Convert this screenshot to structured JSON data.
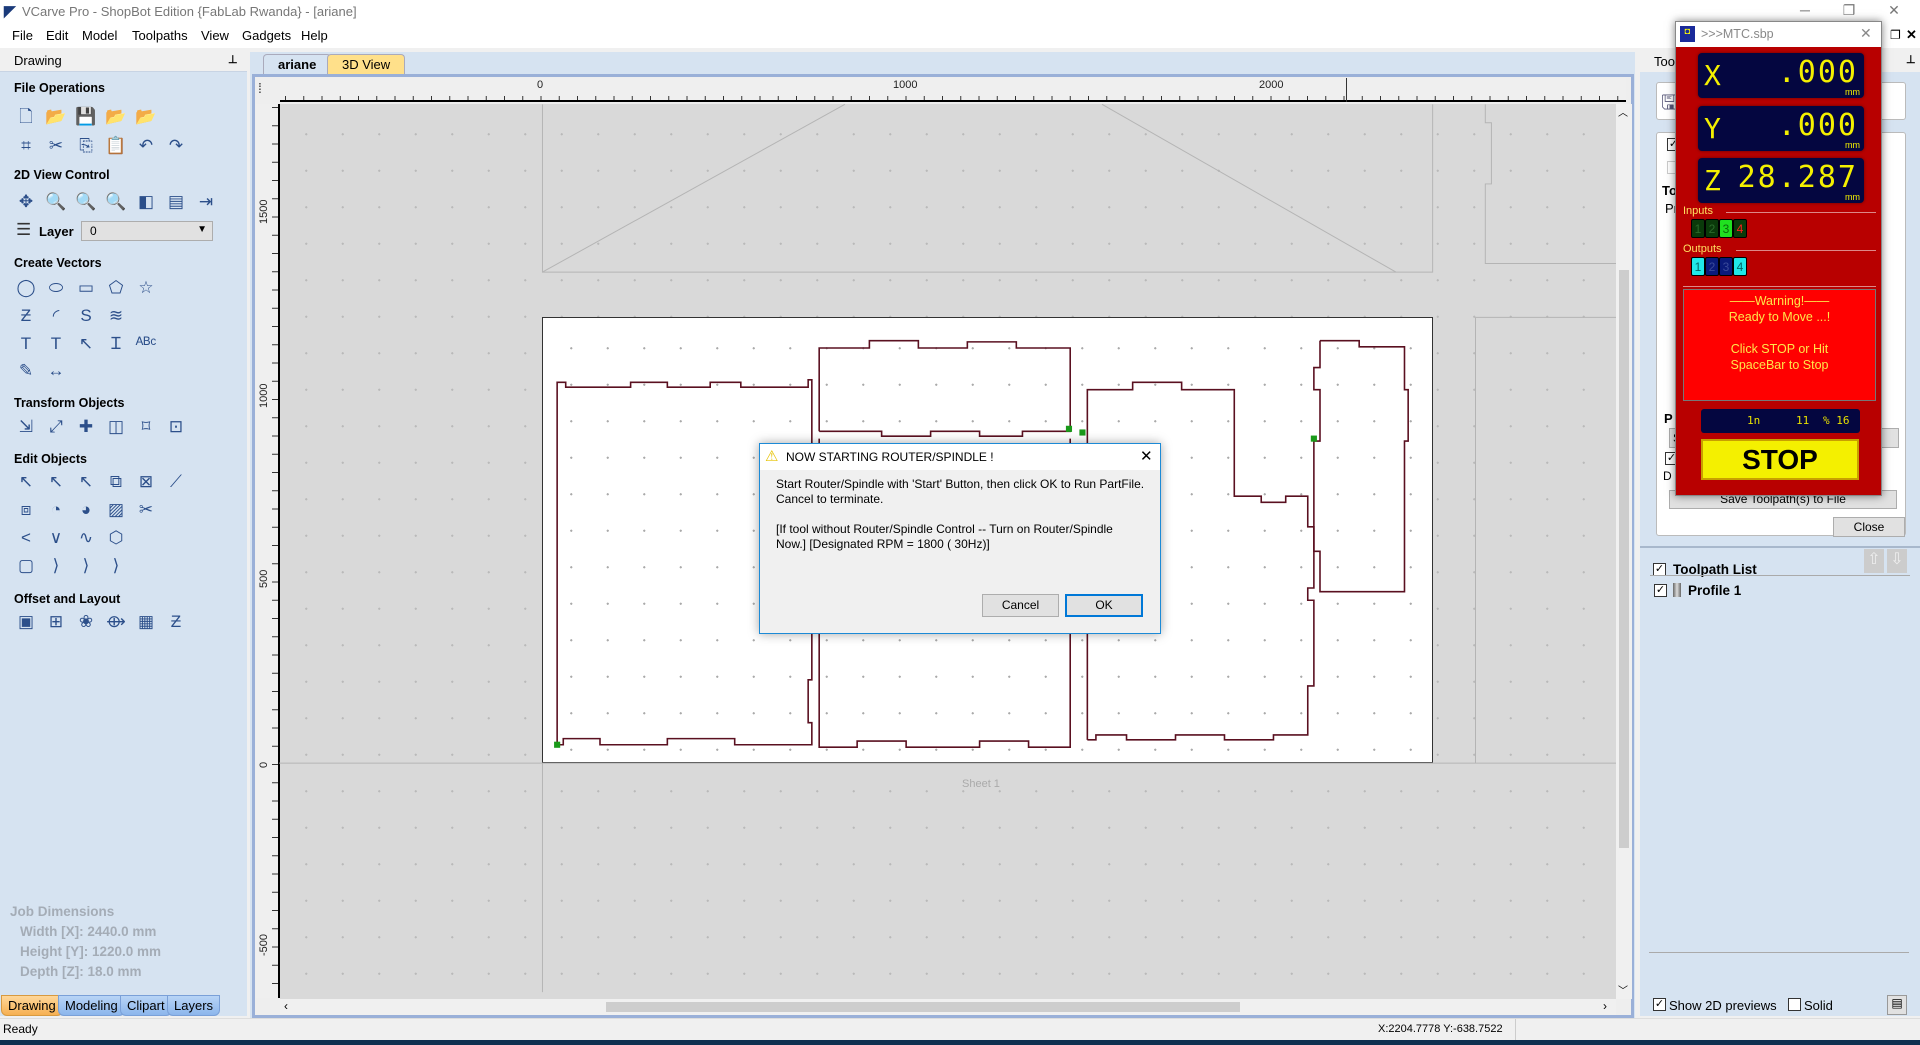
{
  "window": {
    "title": "VCarve Pro - ShopBot Edition {FabLab Rwanda} - [ariane]",
    "minimize": "─",
    "restore": "❐",
    "close": "✕"
  },
  "menu": [
    "File",
    "Edit",
    "Model",
    "Toolpaths",
    "View",
    "Gadgets",
    "Help"
  ],
  "left_panel": {
    "title": "Drawing",
    "sections": {
      "file_operations": "File Operations",
      "view_control": "2D View Control",
      "create_vectors": "Create Vectors",
      "transform": "Transform Objects",
      "edit": "Edit Objects",
      "offset": "Offset and Layout"
    },
    "layer_label": "Layer",
    "layer_value": "0",
    "job_dimensions": {
      "title": "Job Dimensions",
      "width": "Width  [X]: 2440.0 mm",
      "height": "Height [Y]: 1220.0 mm",
      "depth": "Depth  [Z]: 18.0 mm"
    },
    "tabs": [
      "Drawing",
      "Modeling",
      "Clipart",
      "Layers"
    ]
  },
  "icons": {
    "file_operations": [
      [
        "new-file",
        "🗋"
      ],
      [
        "open-folder",
        "📂"
      ],
      [
        "save",
        "💾"
      ],
      [
        "open-recent",
        "📂"
      ],
      [
        "import",
        "📂"
      ],
      [
        "select-all",
        "⌗"
      ],
      [
        "cut",
        "✂"
      ],
      [
        "copy",
        "⎘"
      ],
      [
        "paste",
        "📋"
      ],
      [
        "undo",
        "↶"
      ],
      [
        "redo",
        "↷"
      ]
    ],
    "view_control": [
      [
        "pan",
        "✥"
      ],
      [
        "zoom-box",
        "🔍"
      ],
      [
        "zoom-fit",
        "🔍"
      ],
      [
        "zoom-selection",
        "🔍"
      ],
      [
        "view-left",
        "◧"
      ],
      [
        "view-center",
        "▤"
      ],
      [
        "view-right",
        "⇥"
      ]
    ],
    "create_vectors": [
      [
        "circle",
        "◯"
      ],
      [
        "ellipse",
        "⬭"
      ],
      [
        "rectangle",
        "▭"
      ],
      [
        "polygon",
        "⬠"
      ],
      [
        "star",
        "☆"
      ],
      [
        "polyline",
        "Ƶ"
      ],
      [
        "arc",
        "◜"
      ],
      [
        "curve",
        "S"
      ],
      [
        "fill-pattern",
        "≋"
      ],
      [
        "text",
        "T"
      ],
      [
        "text-box",
        "T"
      ],
      [
        "text-on-curve",
        "↖"
      ],
      [
        "auto-text",
        "Ɪ"
      ],
      [
        "arc-text",
        "ᴬᴮᶜ"
      ],
      [
        "bitmap-trace",
        "✎"
      ],
      [
        "dimension",
        "↔"
      ]
    ],
    "transform": [
      [
        "move",
        "⇲"
      ],
      [
        "scale",
        "⤢"
      ],
      [
        "align",
        "✚"
      ],
      [
        "mirror",
        "◫"
      ],
      [
        "distort",
        "⌑"
      ],
      [
        "center",
        "⊡"
      ]
    ],
    "edit": [
      [
        "select",
        "↖"
      ],
      [
        "node-edit",
        "↖"
      ],
      [
        "transform-select",
        "↖"
      ],
      [
        "group",
        "⧉"
      ],
      [
        "ungroup",
        "⊠"
      ],
      [
        "measure",
        "⟋"
      ],
      [
        "weld",
        "⧈"
      ],
      [
        "subtract",
        "◔"
      ],
      [
        "intersect",
        "◕"
      ],
      [
        "trim",
        "▨"
      ],
      [
        "scissors",
        "✂"
      ],
      [
        "node-corner",
        "<"
      ],
      [
        "node-smooth",
        "∨"
      ],
      [
        "curve-fit",
        "∿"
      ],
      [
        "join",
        "⬡"
      ],
      [
        "fillet",
        "▢"
      ],
      [
        "chamfer",
        "⟩"
      ],
      [
        "dogbone",
        "⟩"
      ],
      [
        "t-bone",
        "⟩"
      ]
    ],
    "offset": [
      [
        "offset",
        "▣"
      ],
      [
        "array-copy",
        "⊞"
      ],
      [
        "circular-array",
        "❀"
      ],
      [
        "copy-along-vector",
        "⟴"
      ],
      [
        "nest",
        "▦"
      ],
      [
        "nest-text",
        "Ƶ"
      ]
    ]
  },
  "document": {
    "tabs": [
      "ariane",
      "3D View"
    ],
    "ruler_top": [
      "0",
      "1000",
      "2000"
    ],
    "ruler_left": [
      "1500",
      "1000",
      "500",
      "0",
      "-500"
    ],
    "sheet_label": "Sheet 1"
  },
  "right_panel": {
    "header": "Too",
    "partial_labels": {
      "to": "To",
      "pr": "Pr",
      "p": "P",
      "d": "D",
      "s": "S"
    },
    "save_button": "Save Toolpath(s) to File",
    "close_button": "Close",
    "toolpath_list_label": "Toolpath List",
    "toolpaths": [
      {
        "name": "Profile 1",
        "checked": true
      }
    ],
    "show_2d_previews": "Show 2D previews",
    "solid": "Solid"
  },
  "mtc": {
    "title": ">>>MTC.sbp",
    "x": {
      "axis": "X",
      "value": ".000",
      "unit": "mm"
    },
    "y": {
      "axis": "Y",
      "value": ".000",
      "unit": "mm"
    },
    "z": {
      "axis": "Z",
      "value": "28.287",
      "unit": "mm"
    },
    "inputs_label": "Inputs",
    "inputs": [
      "1",
      "2",
      "3",
      "4"
    ],
    "outputs_label": "Outputs",
    "outputs": [
      "1",
      "2",
      "3",
      "4"
    ],
    "warning": [
      "——Warning!——",
      "Ready to Move ...!",
      "",
      "Click STOP or Hit",
      "SpaceBar to Stop"
    ],
    "counter": {
      "a": "1n",
      "b": "11",
      "c": "% 16"
    },
    "stop": "STOP"
  },
  "dialog": {
    "title": "NOW STARTING ROUTER/SPINDLE !",
    "line1": "Start Router/Spindle with 'Start' Button, then click OK to Run PartFile.",
    "line2": "Cancel to terminate.",
    "line3": "[If tool without Router/Spindle Control -- Turn on Router/Spindle",
    "line4": "Now.]  [Designated RPM = 1800 ( 30Hz)]",
    "cancel": "Cancel",
    "ok": "OK"
  },
  "status": {
    "text": "Ready",
    "coords": "X:2204.7778 Y:-638.7522"
  },
  "colors": {
    "panel": "#d6e3f1",
    "toolpath": "#5a1020",
    "mtc_red": "#b80000",
    "dro_text": "#f4f000",
    "stop_yellow": "#f4f000"
  }
}
